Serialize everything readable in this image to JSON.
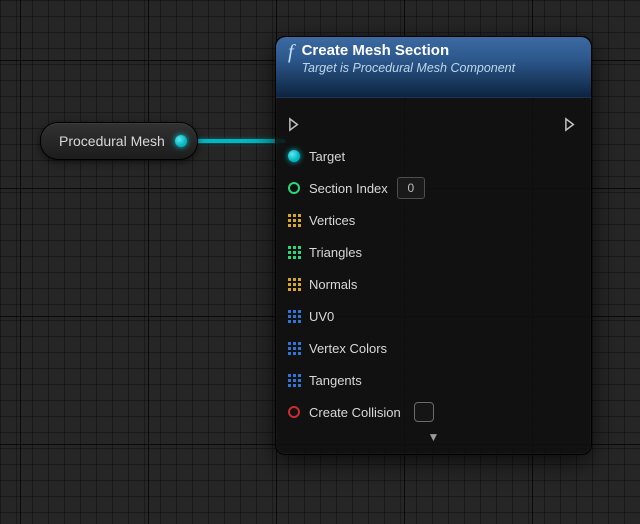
{
  "variable_node": {
    "label": "Procedural Mesh"
  },
  "node": {
    "title": "Create Mesh Section",
    "subtitle": "Target is Procedural Mesh Component",
    "pins": {
      "target": {
        "label": "Target"
      },
      "section_index": {
        "label": "Section Index",
        "value": "0"
      },
      "vertices": {
        "label": "Vertices"
      },
      "triangles": {
        "label": "Triangles"
      },
      "normals": {
        "label": "Normals"
      },
      "uv0": {
        "label": "UV0"
      },
      "vertex_colors": {
        "label": "Vertex Colors"
      },
      "tangents": {
        "label": "Tangents"
      },
      "create_collision": {
        "label": "Create Collision"
      }
    }
  },
  "colors": {
    "vector": "#d8a32f",
    "int_arr": "#28d879",
    "linear": "#2f74d8",
    "struct": "#2f74d8"
  }
}
